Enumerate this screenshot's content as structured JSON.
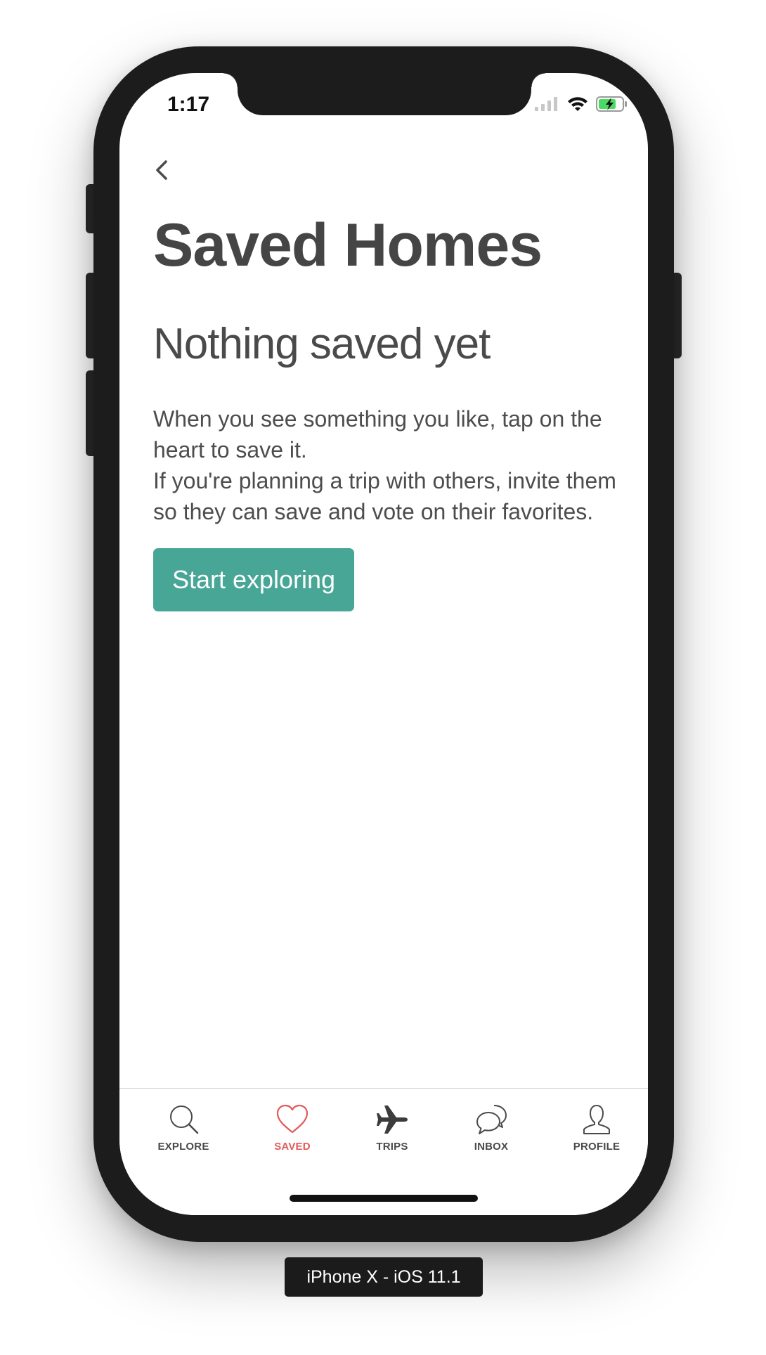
{
  "status_bar": {
    "time": "1:17",
    "battery": "charging"
  },
  "header": {
    "back_icon": "chevron-left-icon",
    "title": "Saved Homes"
  },
  "empty_state": {
    "heading": "Nothing saved yet",
    "line1": "When you see something you like, tap on the heart to save it.",
    "line2": "If you're planning a trip with others, invite them so they can save and vote on their favorites.",
    "button_label": "Start exploring"
  },
  "tabs": [
    {
      "label": "EXPLORE",
      "icon": "search-icon",
      "active": false
    },
    {
      "label": "SAVED",
      "icon": "heart-icon",
      "active": true
    },
    {
      "label": "TRIPS",
      "icon": "airplane-icon",
      "active": false
    },
    {
      "label": "INBOX",
      "icon": "chat-bubbles-icon",
      "active": false
    },
    {
      "label": "PROFILE",
      "icon": "user-icon",
      "active": false
    }
  ],
  "colors": {
    "accent": "#48a697",
    "active_tab": "#e35a5a",
    "text": "#454545"
  },
  "device_label": "iPhone X - iOS 11.1"
}
